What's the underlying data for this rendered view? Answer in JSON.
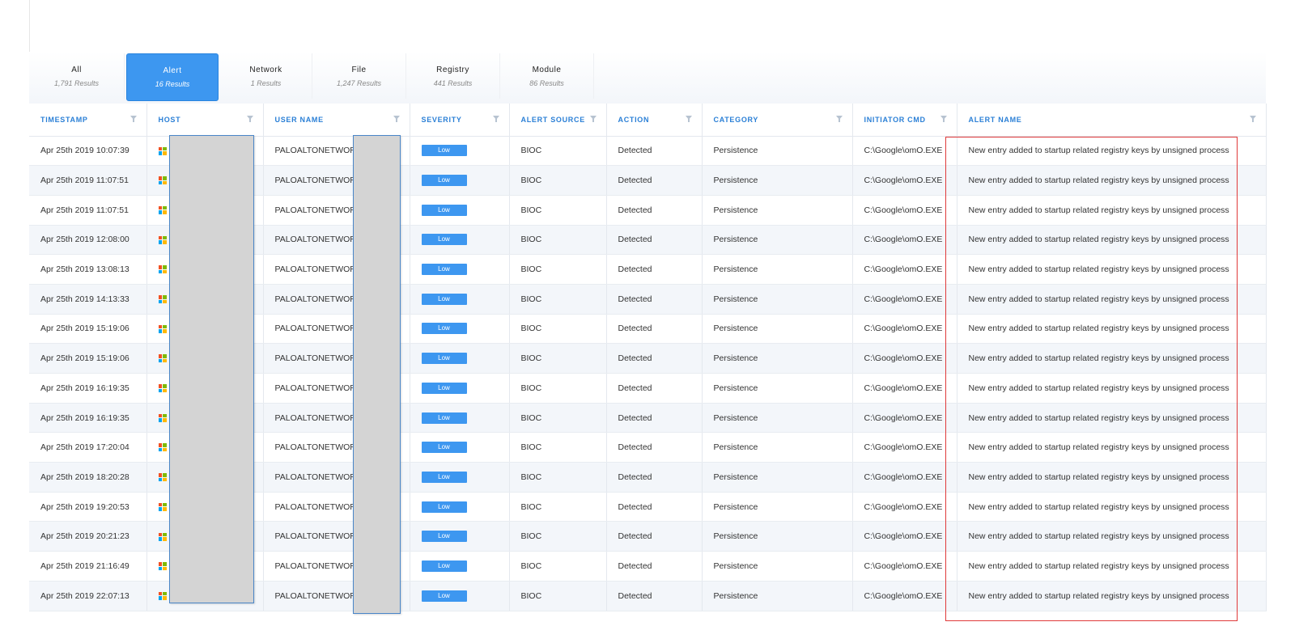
{
  "tabs": [
    {
      "label": "All",
      "count": "1,791 Results",
      "active": false
    },
    {
      "label": "Alert",
      "count": "16 Results",
      "active": true
    },
    {
      "label": "Network",
      "count": "1 Results",
      "active": false
    },
    {
      "label": "File",
      "count": "1,247 Results",
      "active": false
    },
    {
      "label": "Registry",
      "count": "441 Results",
      "active": false
    },
    {
      "label": "Module",
      "count": "86 Results",
      "active": false
    }
  ],
  "columns": [
    "TIMESTAMP",
    "HOST",
    "USER NAME",
    "SEVERITY",
    "ALERT SOURCE",
    "ACTION",
    "CATEGORY",
    "INITIATOR CMD",
    "ALERT NAME"
  ],
  "row_defaults": {
    "host_icon": "windows-icon",
    "user_name": "PALOALTONETWORK",
    "severity": "Low",
    "alert_source": "BIOC",
    "action": "Detected",
    "category": "Persistence",
    "initiator_cmd": "C:\\Google\\omO.EXE",
    "alert_name": "New entry added to startup related registry keys by unsigned process"
  },
  "rows": [
    {
      "timestamp": "Apr 25th 2019 10:07:39"
    },
    {
      "timestamp": "Apr 25th 2019 11:07:51"
    },
    {
      "timestamp": "Apr 25th 2019 11:07:51"
    },
    {
      "timestamp": "Apr 25th 2019 12:08:00"
    },
    {
      "timestamp": "Apr 25th 2019 13:08:13"
    },
    {
      "timestamp": "Apr 25th 2019 14:13:33"
    },
    {
      "timestamp": "Apr 25th 2019 15:19:06"
    },
    {
      "timestamp": "Apr 25th 2019 15:19:06"
    },
    {
      "timestamp": "Apr 25th 2019 16:19:35"
    },
    {
      "timestamp": "Apr 25th 2019 16:19:35"
    },
    {
      "timestamp": "Apr 25th 2019 17:20:04"
    },
    {
      "timestamp": "Apr 25th 2019 18:20:28"
    },
    {
      "timestamp": "Apr 25th 2019 19:20:53"
    },
    {
      "timestamp": "Apr 25th 2019 20:21:23"
    },
    {
      "timestamp": "Apr 25th 2019 21:16:49"
    },
    {
      "timestamp": "Apr 25th 2019 22:07:13"
    }
  ],
  "colors": {
    "accent": "#3d97f0",
    "header_text": "#2a7fd6",
    "highlight_box": "#e03a3a",
    "redaction": "#d4d4d4"
  }
}
